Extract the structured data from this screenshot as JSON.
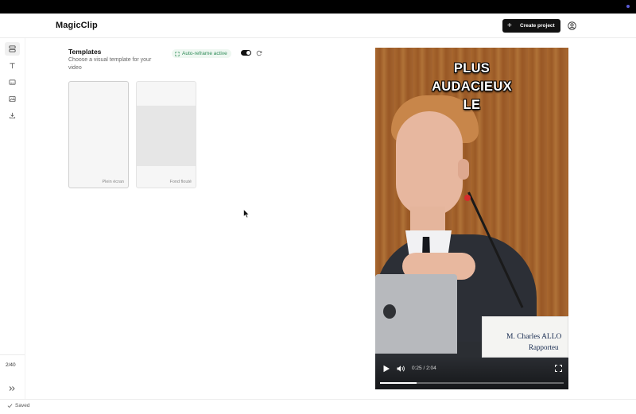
{
  "app": {
    "title": "MagicClip"
  },
  "header": {
    "create_label": "Create project",
    "plus_glyph": "+"
  },
  "sidebar": {
    "items": [
      {
        "name": "layout-icon",
        "active": true
      },
      {
        "name": "text-icon",
        "active": false
      },
      {
        "name": "subtitles-icon",
        "active": false
      },
      {
        "name": "image-icon",
        "active": false
      },
      {
        "name": "download-icon",
        "active": false
      }
    ],
    "page_count": "2/40"
  },
  "templates": {
    "title": "Templates",
    "subtitle": "Choose a visual template for your video",
    "reframe_label": "Auto-reframe active",
    "reframe_enabled": true,
    "cards": [
      {
        "label": "Plein écran",
        "selected": true
      },
      {
        "label": "Fond flouté",
        "selected": false
      }
    ]
  },
  "video": {
    "caption_lines": [
      "PLUS",
      "AUDACIEUX",
      "LE"
    ],
    "nameplate_name": "M. Charles ALLO",
    "nameplate_role": "Rapporteu",
    "time": "0:25 / 2:04",
    "progress": 0.2
  },
  "status": {
    "saved_label": "Saved"
  },
  "colors": {
    "accent_green": "#2e8b57",
    "button_dark": "#111111"
  }
}
